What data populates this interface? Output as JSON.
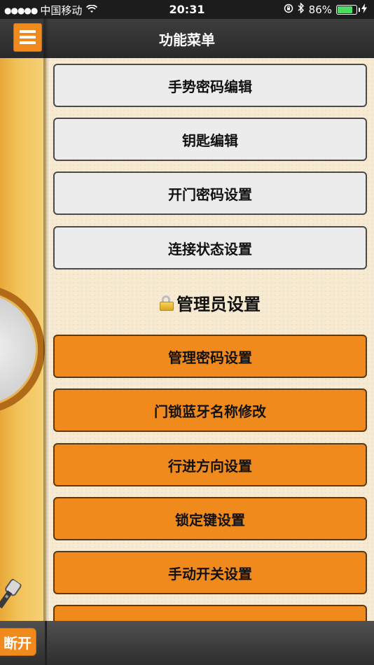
{
  "status_bar": {
    "signal": "●●●●●",
    "carrier": "中国移动",
    "time": "20:31",
    "battery_percent": "86%",
    "battery_level": 0.86
  },
  "header": {
    "title": "功能菜单"
  },
  "menu": {
    "items": [
      {
        "label": "手势密码编辑"
      },
      {
        "label": "钥匙编辑"
      },
      {
        "label": "开门密码设置"
      },
      {
        "label": "连接状态设置"
      }
    ],
    "admin_section_title": "管理员设置",
    "admin_items": [
      {
        "label": "管理密码设置"
      },
      {
        "label": "门锁蓝牙名称修改"
      },
      {
        "label": "行进方向设置"
      },
      {
        "label": "锁定键设置"
      },
      {
        "label": "手动开关设置"
      }
    ]
  },
  "bottom": {
    "disconnect_label": "断开"
  },
  "colors": {
    "accent": "#f08a1c",
    "button_gray": "#ececec",
    "header": "#2f2f2f"
  }
}
